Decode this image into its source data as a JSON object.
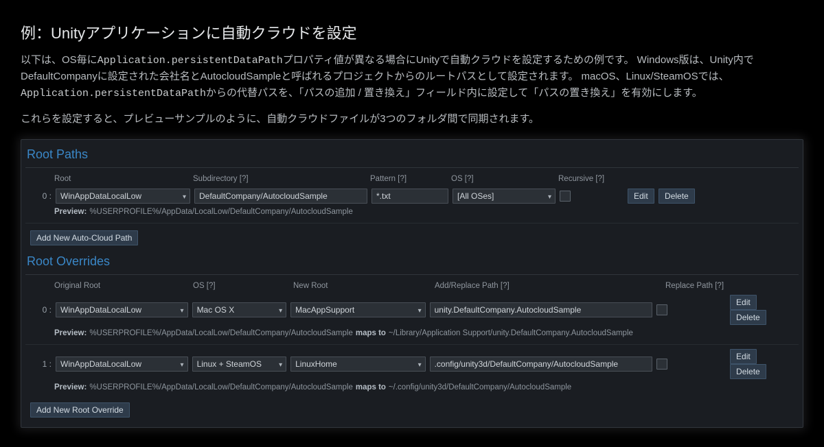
{
  "heading": "例：Unityアプリケーションに自動クラウドを設定",
  "para1_a": "以下は、OS毎に",
  "para1_code1": "Application.persistentDataPath",
  "para1_b": "プロパティ値が異なる場合にUnityで自動クラウドを設定するための例です。 Windows版は、Unity内でDefaultCompanyに設定された会社名とAutocloudSampleと呼ばれるプロジェクトからのルートパスとして設定されます。 macOS、Linux/SteamOSでは、",
  "para1_code2": "Application.persistentDataPath",
  "para1_c": "からの代替パスを、「パスの追加 / 置き換え」フィールド内に設定して「パスの置き換え」を有効にします。",
  "para2": "これらを設定すると、プレビューサンプルのように、自動クラウドファイルが3つのフォルダ間で同期されます。",
  "rootPaths": {
    "title": "Root Paths",
    "headers": {
      "root": "Root",
      "sub": "Subdirectory [?]",
      "pat": "Pattern [?]",
      "os": "OS [?]",
      "rec": "Recursive [?]"
    },
    "row": {
      "index": "0 :",
      "root": "WinAppDataLocalLow",
      "sub": "DefaultCompany/AutocloudSample",
      "pat": "*.txt",
      "os": "[All OSes]",
      "edit": "Edit",
      "del": "Delete",
      "previewLabel": "Preview:",
      "preview": "%USERPROFILE%/AppData/LocalLow/DefaultCompany/AutocloudSample"
    },
    "addBtn": "Add New Auto-Cloud Path"
  },
  "rootOverrides": {
    "title": "Root Overrides",
    "headers": {
      "oroot": "Original Root",
      "os": "OS [?]",
      "nroot": "New Root",
      "path": "Add/Replace Path [?]",
      "repl": "Replace Path [?]"
    },
    "rows": [
      {
        "index": "0 :",
        "oroot": "WinAppDataLocalLow",
        "os": "Mac OS X",
        "nroot": "MacAppSupport",
        "path": "unity.DefaultCompany.AutocloudSample",
        "edit": "Edit",
        "del": "Delete",
        "previewLabel": "Preview:",
        "previewA": "%USERPROFILE%/AppData/LocalLow/DefaultCompany/AutocloudSample",
        "maps": "maps to",
        "previewB": "~/Library/Application Support/unity.DefaultCompany.AutocloudSample"
      },
      {
        "index": "1 :",
        "oroot": "WinAppDataLocalLow",
        "os": "Linux + SteamOS",
        "nroot": "LinuxHome",
        "path": ".config/unity3d/DefaultCompany/AutocloudSample",
        "edit": "Edit",
        "del": "Delete",
        "previewLabel": "Preview:",
        "previewA": "%USERPROFILE%/AppData/LocalLow/DefaultCompany/AutocloudSample",
        "maps": "maps to",
        "previewB": "~/.config/unity3d/DefaultCompany/AutocloudSample"
      }
    ],
    "addBtn": "Add New Root Override"
  }
}
